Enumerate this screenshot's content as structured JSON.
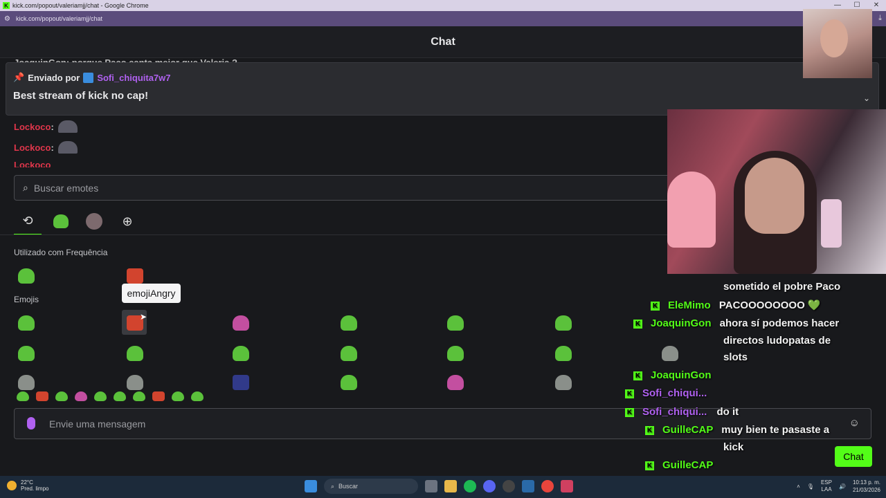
{
  "window": {
    "title": "kick.com/popout/valeriamjj/chat - Google Chrome",
    "url": "kick.com/popout/valeriamjj/chat",
    "controls": [
      "—",
      "☐",
      "✕"
    ]
  },
  "header": {
    "title": "Chat"
  },
  "peek_line": "JoaquinGon: porque Paco canta mejor que Valeria ?",
  "pinned": {
    "prefix": "Enviado por",
    "user": "Sofi_chiquita7w7",
    "message": "Best stream of kick no cap!"
  },
  "chat_lines": [
    {
      "user": "Lockoco",
      "sep": ":"
    },
    {
      "user": "Lockoco",
      "sep": ":"
    },
    {
      "user": "Lockoco",
      "sep": ":"
    }
  ],
  "emote_picker": {
    "search_placeholder": "Buscar emotes",
    "tabs": [
      "recent-icon",
      "kick-emotes-icon",
      "channel-avatar-icon",
      "global-icon"
    ],
    "section_frequent": "Utilizado com Frequência",
    "section_emojis": "Emojis",
    "tooltip": "emojiAngry"
  },
  "message_input": {
    "placeholder": "Envie uma mensagem"
  },
  "chat_button": "Chat",
  "overlay_chat": [
    {
      "user": "",
      "text": "sometido el pobre Paco"
    },
    {
      "user": "EleMimo",
      "text": "PACOOOOOOOO 💚"
    },
    {
      "user": "JoaquinGon",
      "text": "ahora sí podemos hacer"
    },
    {
      "user": "",
      "text": "directos ludopatas de"
    },
    {
      "user": "",
      "text": "slots"
    },
    {
      "user": "JoaquinGon",
      "text": ""
    },
    {
      "user": "Sofi_chiqui...",
      "text": ""
    },
    {
      "user": "Sofi_chiqui...",
      "text": "do it"
    },
    {
      "user": "GuilleCAP",
      "text": "muy bien te pasaste a"
    },
    {
      "user": "",
      "text": "kick"
    },
    {
      "user": "GuilleCAP",
      "text": ""
    }
  ],
  "taskbar": {
    "weather_temp": "22°C",
    "weather_desc": "Pred. limpo",
    "search": "Buscar",
    "lang": "ESP",
    "lang2": "LAA",
    "time": "10:13 p. m.",
    "date": "21/03/2026"
  },
  "colors": {
    "accent": "#53fc18",
    "purple": "#b061f0",
    "red_name": "#e0364b"
  }
}
